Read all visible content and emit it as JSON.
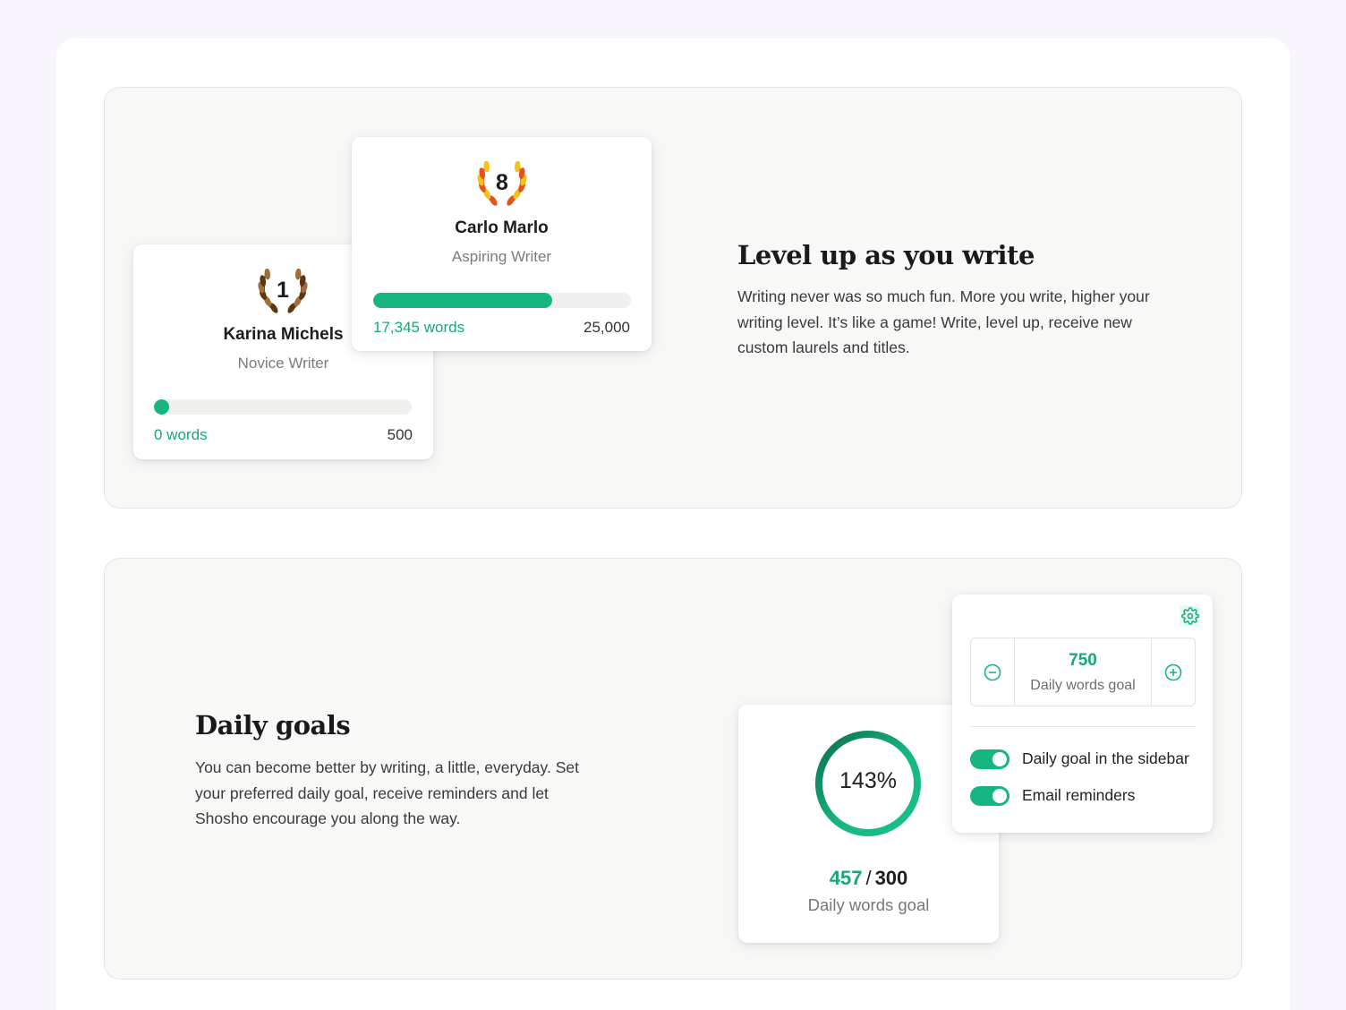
{
  "level_section": {
    "heading": "Level up as you write",
    "description": "Writing never was so much fun. More you write, higher your writing level. It’s like a game! Write, level up, receive new custom laurels and titles.",
    "cards": [
      {
        "level": "1",
        "name": "Karina Michels",
        "title": "Novice Writer",
        "words": "0 words",
        "target": "500",
        "progress": 0.0,
        "laurel_color": "#8a5a2b"
      },
      {
        "level": "8",
        "name": "Carlo Marlo",
        "title": "Aspiring Writer",
        "words": "17,345 words",
        "target": "25,000",
        "progress": 0.6938,
        "laurel_color": "#f0a820"
      }
    ]
  },
  "goals_section": {
    "heading": "Daily goals",
    "description": "You can become better by writing, a little, everyday. Set your preferred daily goal, receive reminders and let Shosho encourage you along the way.",
    "progress_card": {
      "percent_label": "143%",
      "percent_value": 143,
      "current": "457",
      "separator": "/",
      "goal": "300",
      "label": "Daily words goal"
    },
    "settings_card": {
      "goal_value": "750",
      "goal_label": "Daily words goal",
      "toggles": [
        {
          "label": "Daily goal in the sidebar",
          "on": true
        },
        {
          "label": "Email reminders",
          "on": true
        }
      ]
    }
  },
  "colors": {
    "accent": "#16b682",
    "accent_text": "#17a874",
    "accent_dark": "#0c6e4e"
  },
  "icons": [
    "laurel-icon",
    "gear-icon",
    "minus-circle-icon",
    "plus-circle-icon"
  ]
}
